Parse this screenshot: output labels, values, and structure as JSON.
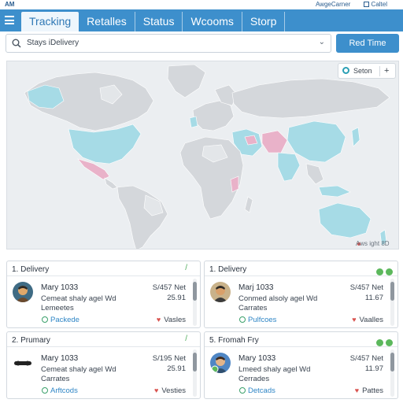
{
  "status": {
    "time": "AM",
    "account": "AwgeCarner",
    "action": "Caltel"
  },
  "nav": {
    "tabs": [
      "Tracking",
      "Retalles",
      "Status",
      "Wcooms",
      "Storp"
    ],
    "active_tab": "Tracking"
  },
  "search": {
    "value": "Stays iDelivery"
  },
  "realtime_button": "Red Time",
  "map": {
    "control_label": "Seton",
    "control_sign": "+",
    "attribution": "Aws ight 8D"
  },
  "cards": [
    {
      "title": "1. Delivery",
      "name": "Mary 1033",
      "ref": "S/457 Net",
      "line2": "Cemeat shaly agel Wd",
      "amount": "25.91",
      "line3": "Lemeetes",
      "status": "Packede",
      "fav": "Vasles"
    },
    {
      "title": "1. Delivery",
      "name": "Marj 1033",
      "ref": "S/457 Net",
      "line2": "Conmed alsoly agel Wd",
      "amount": "11.67",
      "line3": "Carrates",
      "status": "Pulfcoes",
      "fav": "Vaalles"
    },
    {
      "title": "2. Prumary",
      "name": "Mary 1033",
      "ref": "S/195 Net",
      "line2": "Cemeat shaly agel Wd",
      "amount": "25.91",
      "line3": "Carrates",
      "status": "Arftcods",
      "fav": "Vesties"
    },
    {
      "title": "5. Fromah Fry",
      "name": "Mary 1033",
      "ref": "S/457 Net",
      "line2": "Lmeed shaly agel Wd",
      "amount": "11.97",
      "line3": "Cerrades",
      "status": "Detcads",
      "fav": "Pattes"
    }
  ],
  "colors": {
    "accent": "#3d8fcc",
    "map_land": "#d4d7db",
    "map_highlight_blue": "#a6dbe6",
    "map_highlight_pink": "#e9b2c9",
    "ocean": "#ebeef1"
  },
  "icons": {
    "menu": "hamburger-icon",
    "search": "search-icon",
    "pin": "pin-icon",
    "check": "check-icon",
    "heart": "heart-icon"
  }
}
